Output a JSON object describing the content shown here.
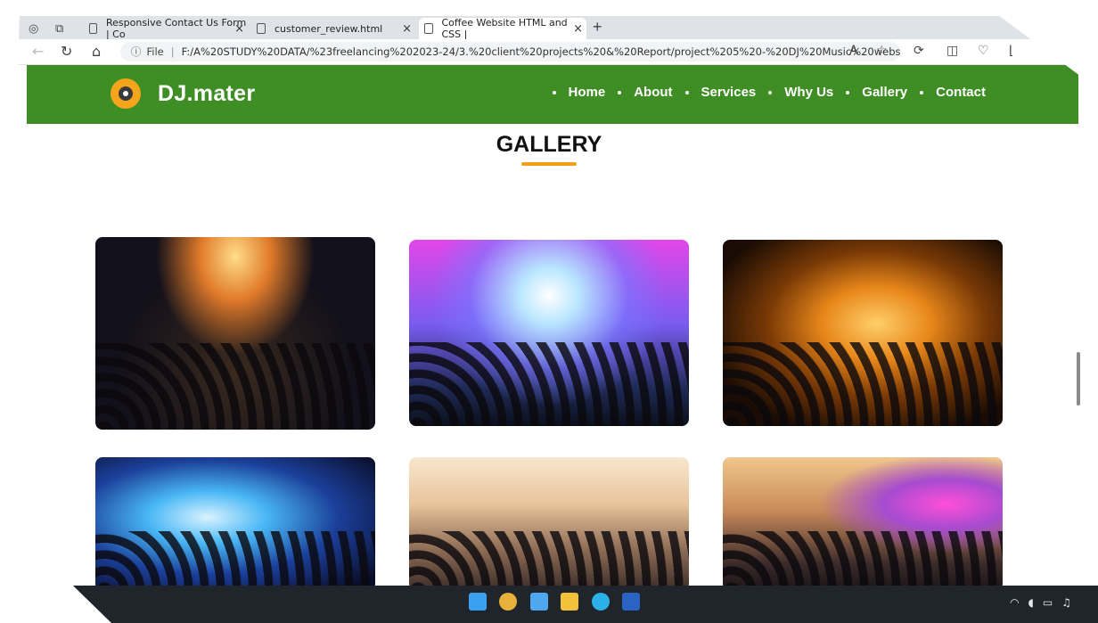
{
  "browser": {
    "tabs": [
      {
        "title": "Responsive Contact Us Form | Co"
      },
      {
        "title": "customer_review.html"
      },
      {
        "title": "Coffee Website HTML and CSS |"
      }
    ],
    "new_tab": "+",
    "close": "×",
    "url_info_icon": "ⓘ",
    "url_file_label": "File",
    "url_separator": "|",
    "url": "F:/A%20STUDY%20DATA/%23freelancing%202023-24/3.%20client%20projects%20&%20Report/project%205%20-%20DJ%20Music%20website/DJ%20..."
  },
  "site": {
    "brand": "DJ.mater",
    "nav": [
      "Home",
      "About",
      "Services",
      "Why Us",
      "Gallery",
      "Contact"
    ],
    "colors": {
      "header_bg": "#3f8e25",
      "accent": "#f29d1f"
    }
  },
  "gallery": {
    "title": "GALLERY",
    "images": [
      {
        "name": "dj-at-turntables-crowd"
      },
      {
        "name": "stage-lights-purple-crowd"
      },
      {
        "name": "orange-fire-concert"
      },
      {
        "name": "laser-light-show"
      },
      {
        "name": "beach-party-dj-headphones"
      },
      {
        "name": "sunset-beach-dj-mixer"
      }
    ]
  }
}
